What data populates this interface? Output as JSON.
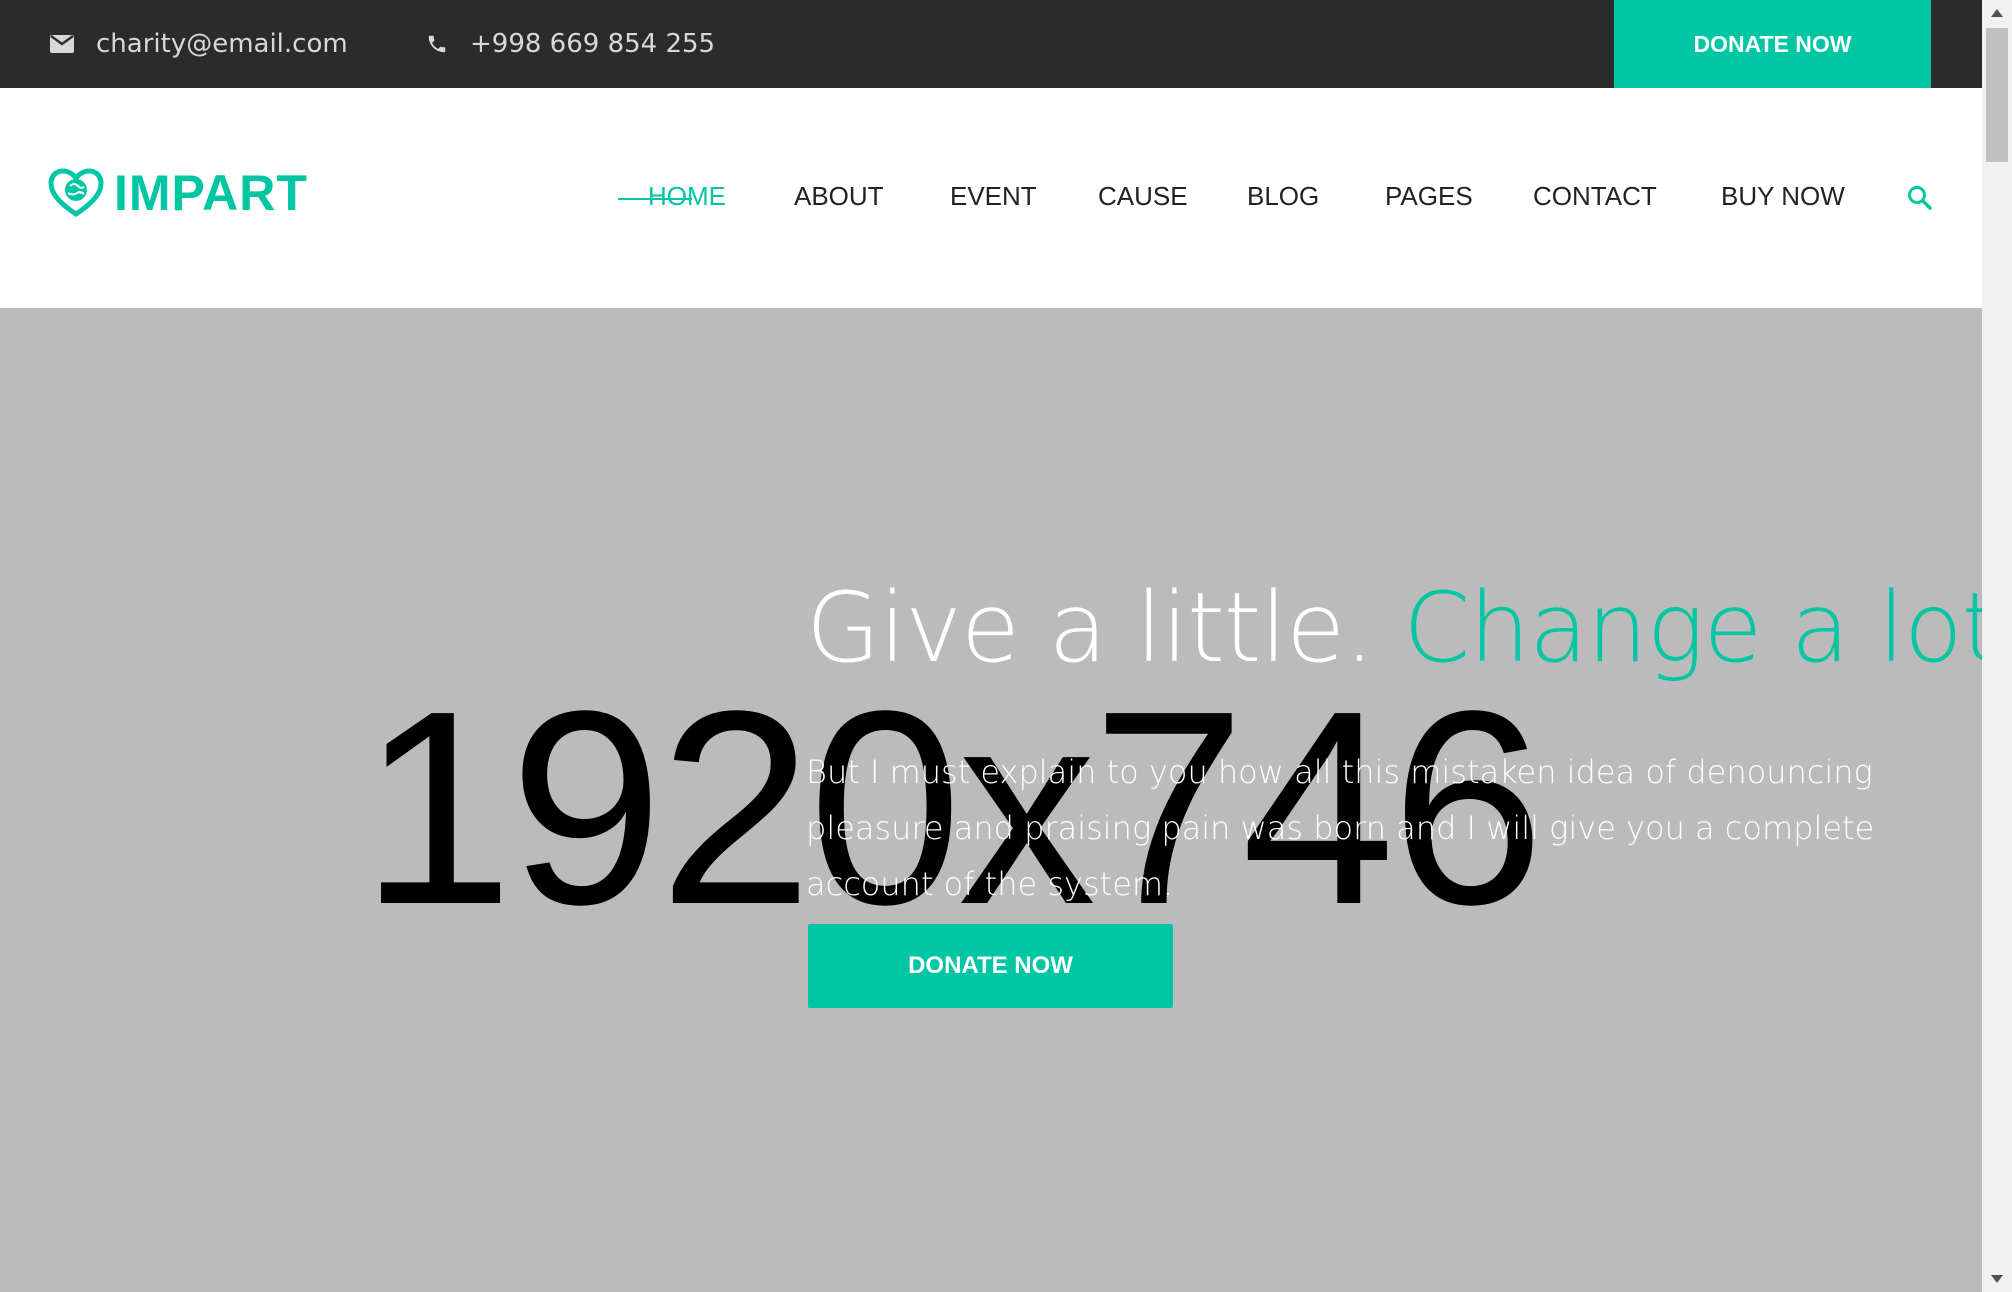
{
  "topbar": {
    "email": "charity@email.com",
    "phone": "+998 669 854 255",
    "donate_label": "DONATE NOW",
    "email_icon": "envelope-icon",
    "phone_icon": "phone-icon"
  },
  "header": {
    "logo_text": "IMPART",
    "logo_icon": "heart-globe-icon",
    "nav": [
      {
        "label": "HOME",
        "active": true
      },
      {
        "label": "ABOUT"
      },
      {
        "label": "EVENT"
      },
      {
        "label": "CAUSE"
      },
      {
        "label": "BLOG"
      },
      {
        "label": "PAGES"
      },
      {
        "label": "CONTACT"
      },
      {
        "label": "BUY NOW"
      }
    ],
    "search_icon": "search-icon"
  },
  "hero": {
    "placeholder": "1920x746",
    "title_part1": "Give a little. ",
    "title_part2": "Change a lot.",
    "text": "But I must explain to you how all this mistaken idea of denouncing pleasure and praising pain was born and I will give you a complete account of the system.",
    "donate_label": "DONATE NOW"
  },
  "colors": {
    "accent": "#00c6a3",
    "topbar_bg": "#2b2b2b",
    "hero_bg": "#bbbbbb"
  }
}
